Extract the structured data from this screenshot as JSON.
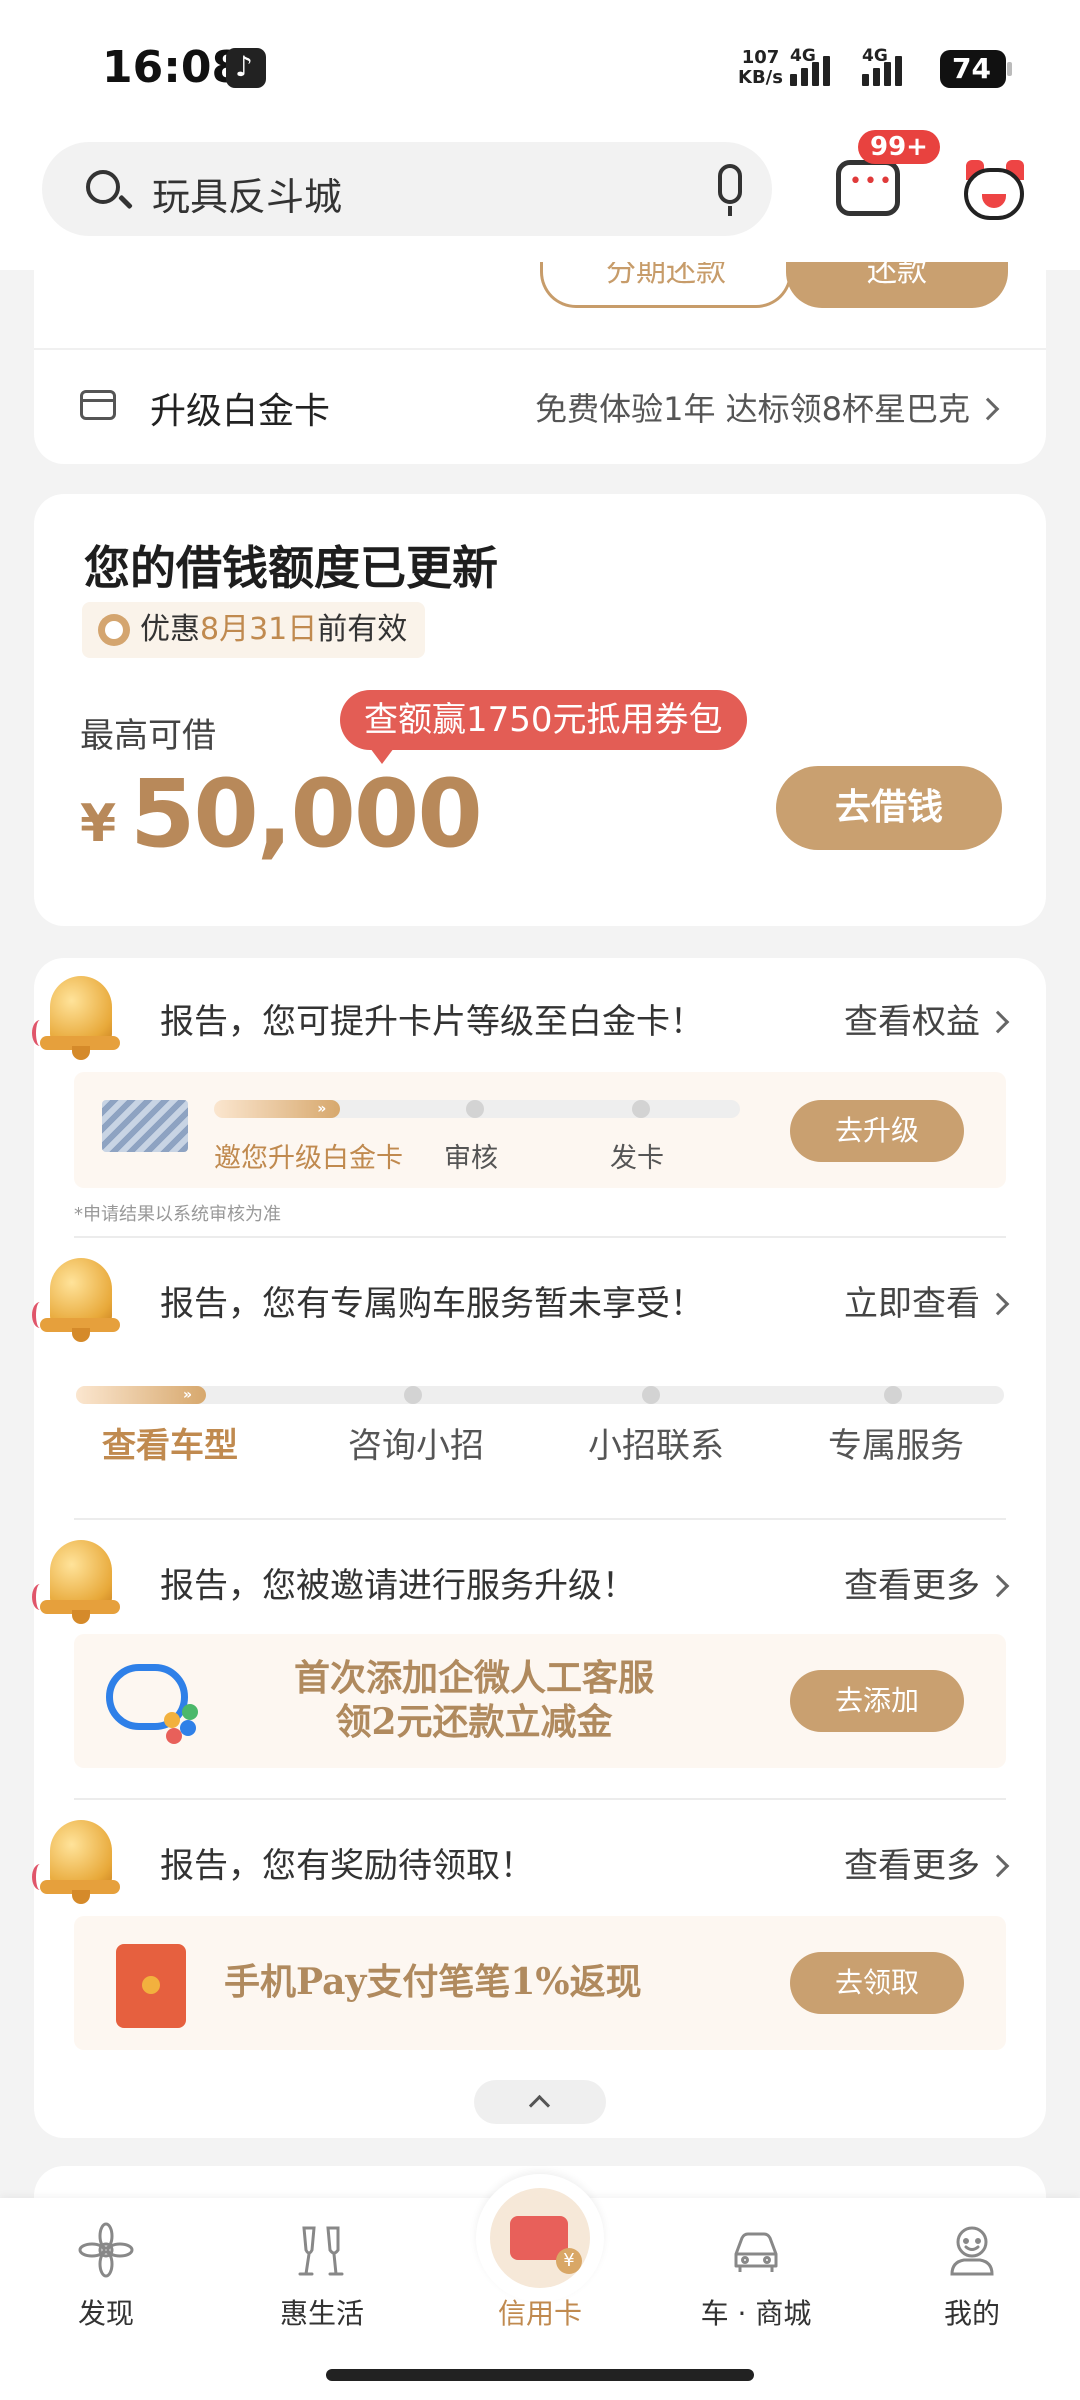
{
  "status_bar": {
    "time": "16:08",
    "net_speed_value": "107",
    "net_speed_unit": "KB/s",
    "signal_1": "4G",
    "signal_2": "4G",
    "battery": "74"
  },
  "header": {
    "search_text": "玩具反斗城",
    "message_badge": "99+"
  },
  "card_top": {
    "left_button": "分期还款",
    "right_button": "还款",
    "upgrade_title": "升级白金卡",
    "upgrade_subtitle": "免费体验1年  达标领8杯星巴克"
  },
  "loan_card": {
    "title": "您的借钱额度已更新",
    "promo_prefix": "优惠",
    "promo_date": "8月31日",
    "promo_suffix": "前有效",
    "max_label": "最高可借",
    "tooltip": "查额赢1750元抵用券包",
    "currency": "¥",
    "amount": "50,000",
    "button": "去借钱"
  },
  "notices": {
    "upgrade": {
      "title": "报告，您可提升卡片等级至白金卡！",
      "link": "查看权益",
      "steps": [
        "邀您升级白金卡",
        "审核",
        "发卡"
      ],
      "progress_fraction": 0.24,
      "button": "去升级",
      "disclaimer": "*申请结果以系统审核为准"
    },
    "car": {
      "title": "报告，您有专属购车服务暂未享受！",
      "link": "立即查看",
      "steps": [
        "查看车型",
        "咨询小招",
        "小招联系",
        "专属服务"
      ]
    },
    "service": {
      "title": "报告，您被邀请进行服务升级！",
      "link": "查看更多",
      "promo_line1": "首次添加企微人工客服",
      "promo_line2": "领2元还款立减金",
      "button": "去添加"
    },
    "reward": {
      "title": "报告，您有奖励待领取！",
      "link": "查看更多",
      "promo": "手机Pay支付笔笔1%返现",
      "button": "去领取"
    }
  },
  "bottom_nav": {
    "items": [
      "发现",
      "惠生活",
      "信用卡",
      "车 · 商城",
      "我的"
    ],
    "active_index": 2
  },
  "colors": {
    "accent_gold": "#c9a070",
    "accent_red": "#e35d55",
    "active_text": "#c08a4f"
  },
  "icons": [
    "search-icon",
    "mic-icon",
    "message-icon",
    "avatar-icon",
    "card-icon",
    "clock-icon",
    "bell-icon",
    "wechat-work-icon",
    "red-packet-icon",
    "flower-icon",
    "glasses-icon",
    "credit-card-icon",
    "car-icon",
    "profile-icon"
  ]
}
